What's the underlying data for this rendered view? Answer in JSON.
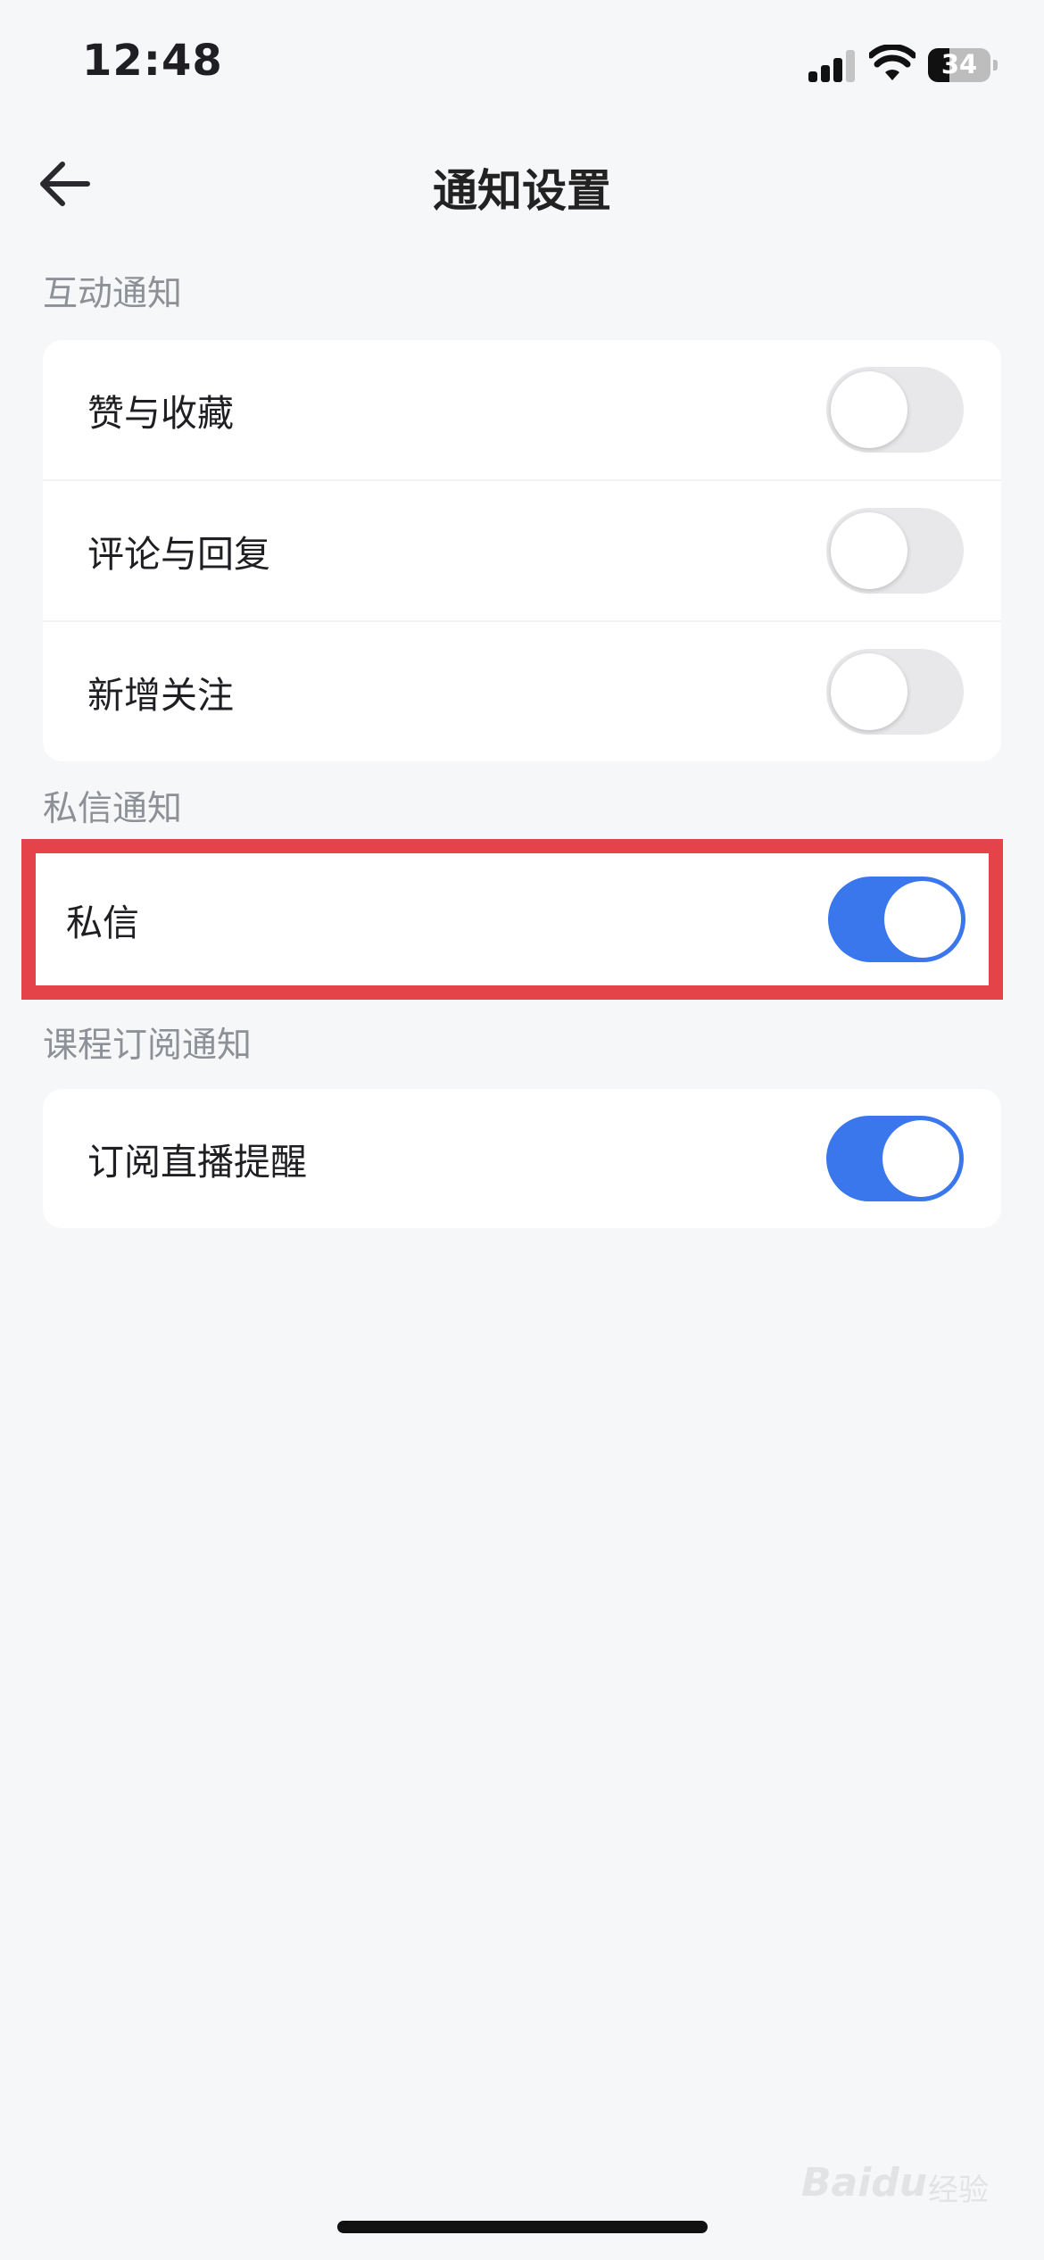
{
  "status_bar": {
    "time": "12:48",
    "battery_level": "34"
  },
  "header": {
    "title": "通知设置"
  },
  "sections": {
    "interaction": {
      "label": "互动通知",
      "items": [
        {
          "label": "赞与收藏",
          "enabled": false
        },
        {
          "label": "评论与回复",
          "enabled": false
        },
        {
          "label": "新增关注",
          "enabled": false
        }
      ]
    },
    "private_message": {
      "label": "私信通知",
      "items": [
        {
          "label": "私信",
          "enabled": true
        }
      ]
    },
    "course_subscription": {
      "label": "课程订阅通知",
      "items": [
        {
          "label": "订阅直播提醒",
          "enabled": true
        }
      ]
    }
  },
  "colors": {
    "accent": "#3a77ed",
    "highlight": "#e5434a",
    "toggle_off": "#e8e8ea"
  },
  "icons": {
    "back": "arrow-left-icon",
    "signal": "cellular-signal-icon",
    "wifi": "wifi-icon",
    "battery": "battery-icon"
  },
  "watermark": {
    "brand": "Baidu",
    "suffix": "经验"
  }
}
